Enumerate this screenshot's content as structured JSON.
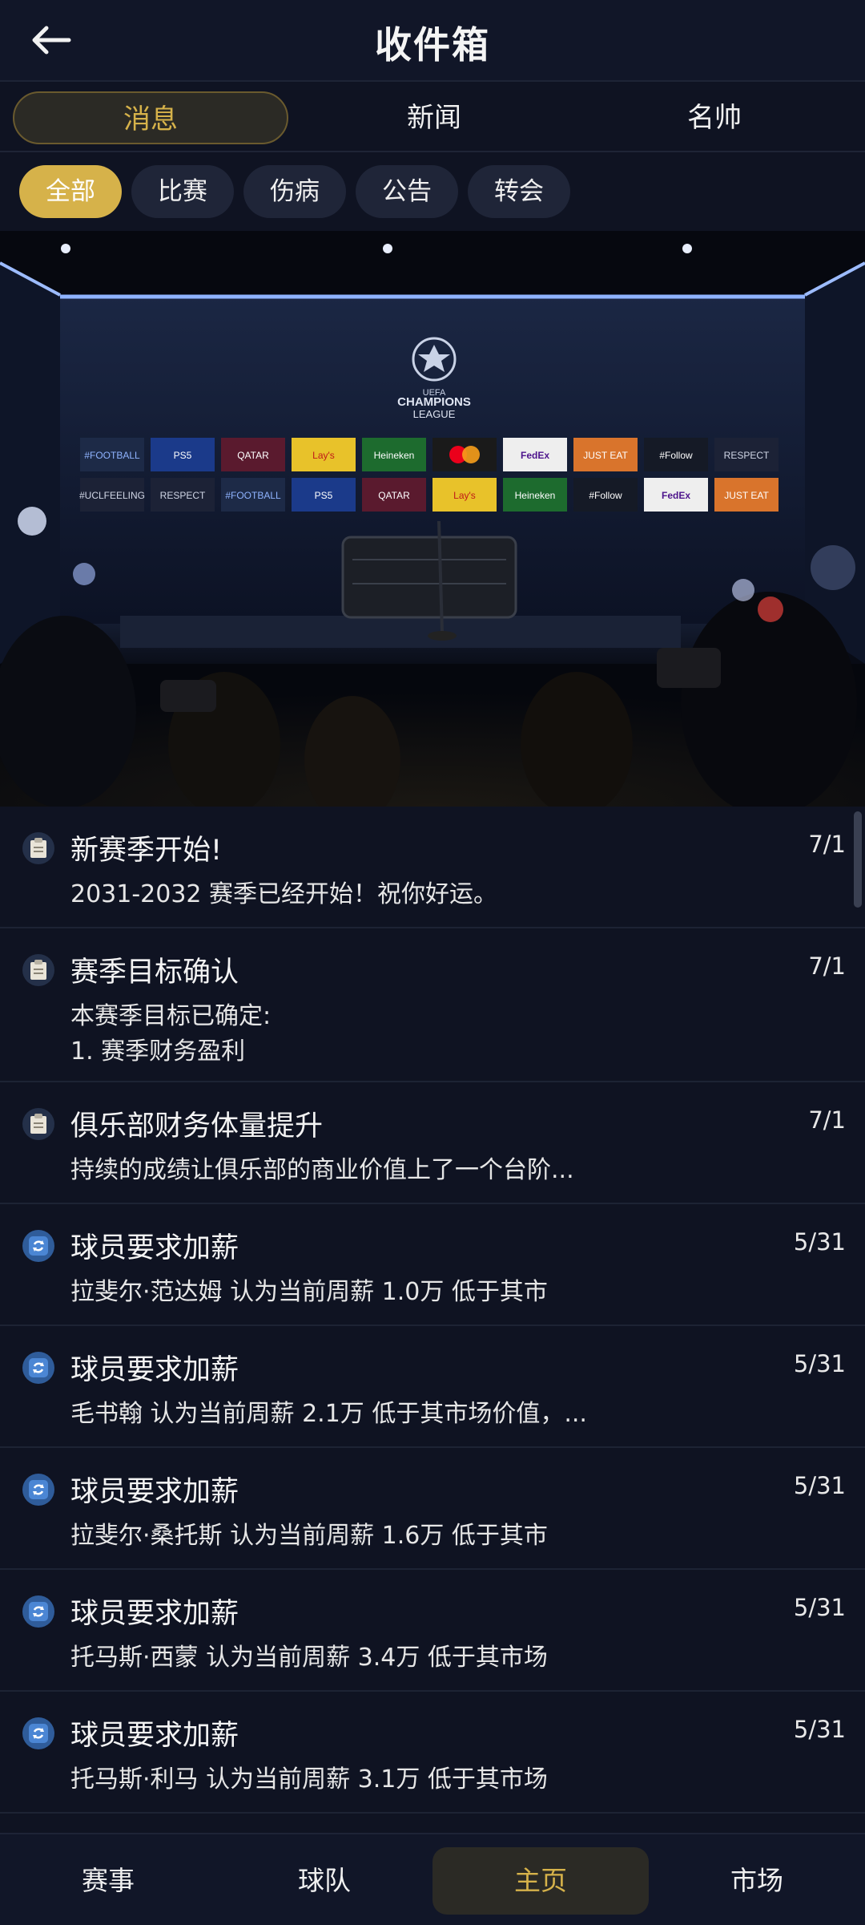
{
  "header": {
    "title": "收件箱",
    "back_icon": "arrow-left-icon"
  },
  "tabs": [
    {
      "label": "消息",
      "active": true
    },
    {
      "label": "新闻",
      "active": false
    },
    {
      "label": "名帅",
      "active": false
    }
  ],
  "filters": [
    {
      "label": "全部",
      "active": true
    },
    {
      "label": "比赛",
      "active": false
    },
    {
      "label": "伤病",
      "active": false
    },
    {
      "label": "公告",
      "active": false
    },
    {
      "label": "转会",
      "active": false
    }
  ],
  "banner": {
    "logo_text": "CHAMPIONS",
    "logo_subtext": "LEAGUE",
    "uefa_text": "UEFA",
    "sponsors_row1": [
      "#FOOTBALL",
      "PS5",
      "QATAR",
      "Lay's",
      "Heineken",
      "mastercard",
      "FedEx",
      "JUST EAT",
      "#Follow",
      "RESPECT"
    ],
    "sponsors_row2": [
      "#UCLFEELING",
      "RESPECT",
      "#FOOTBALL",
      "PS5",
      "QATAR",
      "Lay's",
      "Heineken",
      "#Follow",
      "FedEx",
      "JUST EAT"
    ]
  },
  "messages": [
    {
      "icon": "clipboard-icon",
      "title": "新赛季开始!",
      "date": "7/1",
      "body": "2031-2032 赛季已经开始！祝你好运。"
    },
    {
      "icon": "clipboard-icon",
      "title": "赛季目标确认",
      "date": "7/1",
      "body": "本赛季目标已确定:\n1. 赛季财务盈利"
    },
    {
      "icon": "clipboard-icon",
      "title": "俱乐部财务体量提升",
      "date": "7/1",
      "body": "持续的成绩让俱乐部的商业价值上了一个台阶..."
    },
    {
      "icon": "refresh-icon",
      "title": "球员要求加薪",
      "date": "5/31",
      "body": "拉斐尔·范达姆 认为当前周薪 1.0万 低于其市"
    },
    {
      "icon": "refresh-icon",
      "title": "球员要求加薪",
      "date": "5/31",
      "body": "毛书翰 认为当前周薪 2.1万 低于其市场价值，..."
    },
    {
      "icon": "refresh-icon",
      "title": "球员要求加薪",
      "date": "5/31",
      "body": "拉斐尔·桑托斯 认为当前周薪 1.6万 低于其市"
    },
    {
      "icon": "refresh-icon",
      "title": "球员要求加薪",
      "date": "5/31",
      "body": "托马斯·西蒙 认为当前周薪 3.4万 低于其市场"
    },
    {
      "icon": "refresh-icon",
      "title": "球员要求加薪",
      "date": "5/31",
      "body": "托马斯·利马 认为当前周薪 3.1万 低于其市场"
    }
  ],
  "bottom_nav": [
    {
      "label": "赛事",
      "active": false
    },
    {
      "label": "球队",
      "active": false
    },
    {
      "label": "主页",
      "active": true
    },
    {
      "label": "市场",
      "active": false
    }
  ],
  "colors": {
    "accent": "#d6b24a",
    "background": "#0f1322",
    "chip": "#1f2538"
  }
}
